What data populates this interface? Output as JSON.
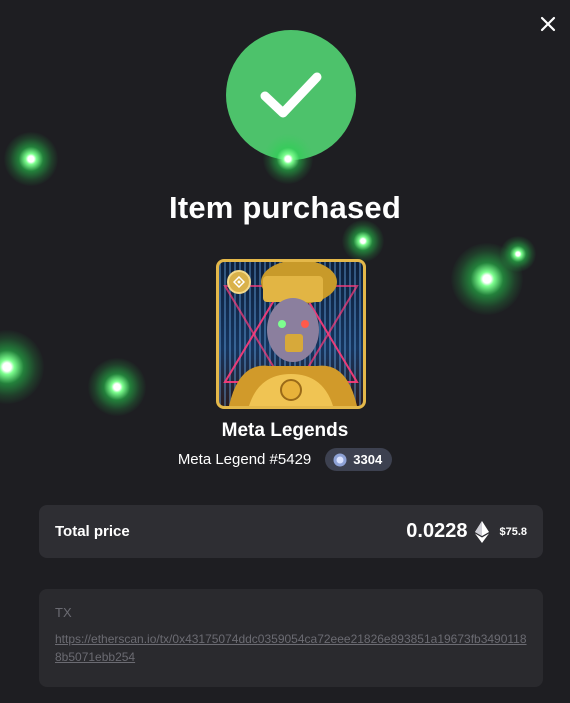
{
  "modal": {
    "title": "Item purchased",
    "close_icon": "close-icon",
    "success_icon": "checkmark-icon"
  },
  "nft": {
    "collection": "Meta Legends",
    "item_name": "Meta Legend #5429",
    "rank": "3304",
    "rank_icon": "rarity-icon",
    "badge_icon": "collection-badge-icon"
  },
  "price": {
    "label": "Total price",
    "eth": "0.0228",
    "currency_icon": "ethereum-icon",
    "usd": "$75.8"
  },
  "tx": {
    "label": "TX",
    "link": "https://etherscan.io/tx/0x43175074ddc0359054ca72eee21826e893851a19673fb34901188b5071ebb254"
  },
  "colors": {
    "background": "#1e1e22",
    "success": "#4dc26b",
    "card": "#2e2e33",
    "frame": "#e4b84a",
    "glow": "#3fdc62"
  }
}
